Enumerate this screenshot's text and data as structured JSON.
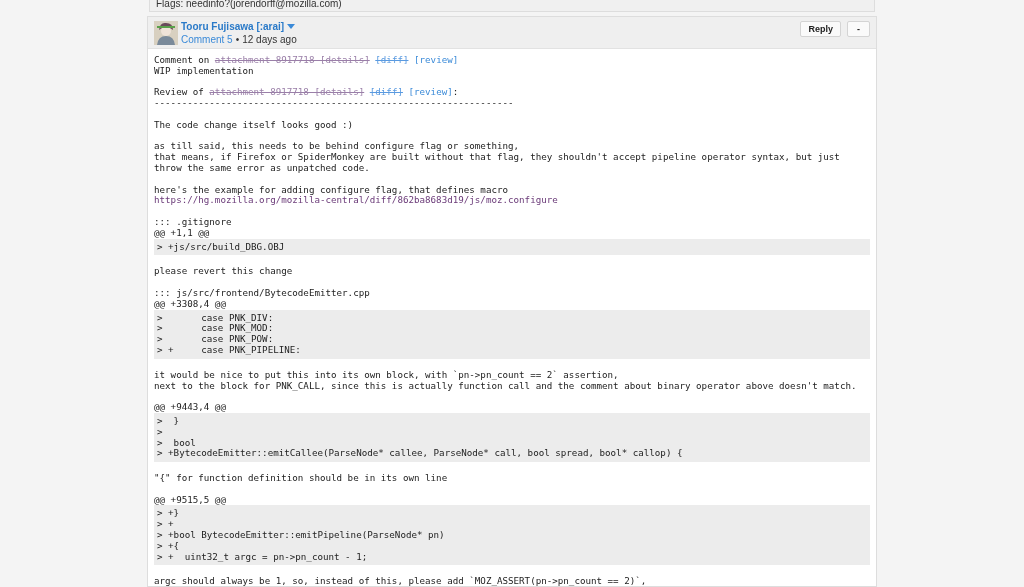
{
  "previous_comment": {
    "flags": "Flags: needinfo?(jorendorff@mozilla.com)"
  },
  "comment": {
    "author": "Tooru Fujisawa [:arai]",
    "number": "Comment 5",
    "separator": "•",
    "time": "12 days ago",
    "buttons": [
      "Reply",
      "-"
    ],
    "body": [
      {
        "kind": "text",
        "lines": [
          [
            {
              "kind": "plain",
              "text": "Comment on "
            },
            {
              "kind": "obsolete",
              "text": "attachment 8917718 [details]"
            },
            {
              "kind": "obsolete-link",
              "text": "[diff]"
            },
            {
              "kind": "link",
              "text": "[review]"
            }
          ],
          [
            {
              "kind": "plain",
              "text": "WIP implementation"
            }
          ]
        ]
      },
      {
        "kind": "text",
        "lines": [
          [
            {
              "kind": "plain",
              "text": "Review of "
            },
            {
              "kind": "obsolete",
              "text": "attachment 8917718 [details]"
            },
            {
              "kind": "obsolete-link",
              "text": "[diff]"
            },
            {
              "kind": "link",
              "text": "[review]"
            },
            {
              "kind": "plain",
              "text": ":"
            }
          ],
          [
            {
              "kind": "plain",
              "text": "-----------------------------------------------------------------"
            }
          ]
        ]
      },
      {
        "kind": "text",
        "lines": [
          [
            {
              "kind": "plain",
              "text": "The code change itself looks good :)"
            }
          ]
        ]
      },
      {
        "kind": "text",
        "lines": [
          [
            {
              "kind": "plain",
              "text": "as till said, this needs to be behind configure flag or something,"
            }
          ],
          [
            {
              "kind": "plain",
              "text": "that means, if Firefox or SpiderMonkey are built without that flag, they shouldn't accept pipeline operator syntax, but just"
            }
          ],
          [
            {
              "kind": "plain",
              "text": "throw the same error as unpatched code."
            }
          ]
        ]
      },
      {
        "kind": "text",
        "lines": [
          [
            {
              "kind": "plain",
              "text": "here's the example for adding configure flag, that defines macro"
            }
          ],
          [
            {
              "kind": "visited",
              "text": "https://hg.mozilla.org/mozilla-central/diff/862ba8683d19/js/moz.configure"
            }
          ]
        ]
      },
      {
        "kind": "quote",
        "heading": [
          "::: .gitignore",
          "@@ +1,1 @@"
        ],
        "lines": [
          "> +js/src/build_DBG.OBJ"
        ]
      },
      {
        "kind": "text",
        "lines": [
          [
            {
              "kind": "plain",
              "text": "please revert this change"
            }
          ]
        ]
      },
      {
        "kind": "quote",
        "heading": [
          "::: js/src/frontend/BytecodeEmitter.cpp",
          "@@ +3308,4 @@"
        ],
        "lines": [
          ">       case PNK_DIV:",
          ">       case PNK_MOD:",
          ">       case PNK_POW:",
          "> +     case PNK_PIPELINE:"
        ]
      },
      {
        "kind": "text",
        "lines": [
          [
            {
              "kind": "plain",
              "text": "it would be nice to put this into its own block, with `pn->pn_count == 2` assertion,"
            }
          ],
          [
            {
              "kind": "plain",
              "text": "next to the block for PNK_CALL, since this is actually function call and the comment about binary operator above doesn't match."
            }
          ]
        ]
      },
      {
        "kind": "quote",
        "heading": [
          "@@ +9443,4 @@"
        ],
        "lines": [
          ">  }",
          ">",
          ">  bool",
          "> +BytecodeEmitter::emitCallee(ParseNode* callee, ParseNode* call, bool spread, bool* callop) {"
        ]
      },
      {
        "kind": "text",
        "lines": [
          [
            {
              "kind": "plain",
              "text": "\"{\" for function definition should be in its own line"
            }
          ]
        ]
      },
      {
        "kind": "quote",
        "heading": [
          "@@ +9515,5 @@"
        ],
        "lines": [
          "> +}",
          "> +",
          "> +bool BytecodeEmitter::emitPipeline(ParseNode* pn)",
          "> +{",
          "> +  uint32_t argc = pn->pn_count - 1;"
        ]
      },
      {
        "kind": "text",
        "lines": [
          [
            {
              "kind": "plain",
              "text": "argc should always be 1, so, instead of this, please add `MOZ_ASSERT(pn->pn_count == 2)`,"
            }
          ]
        ]
      }
    ]
  }
}
